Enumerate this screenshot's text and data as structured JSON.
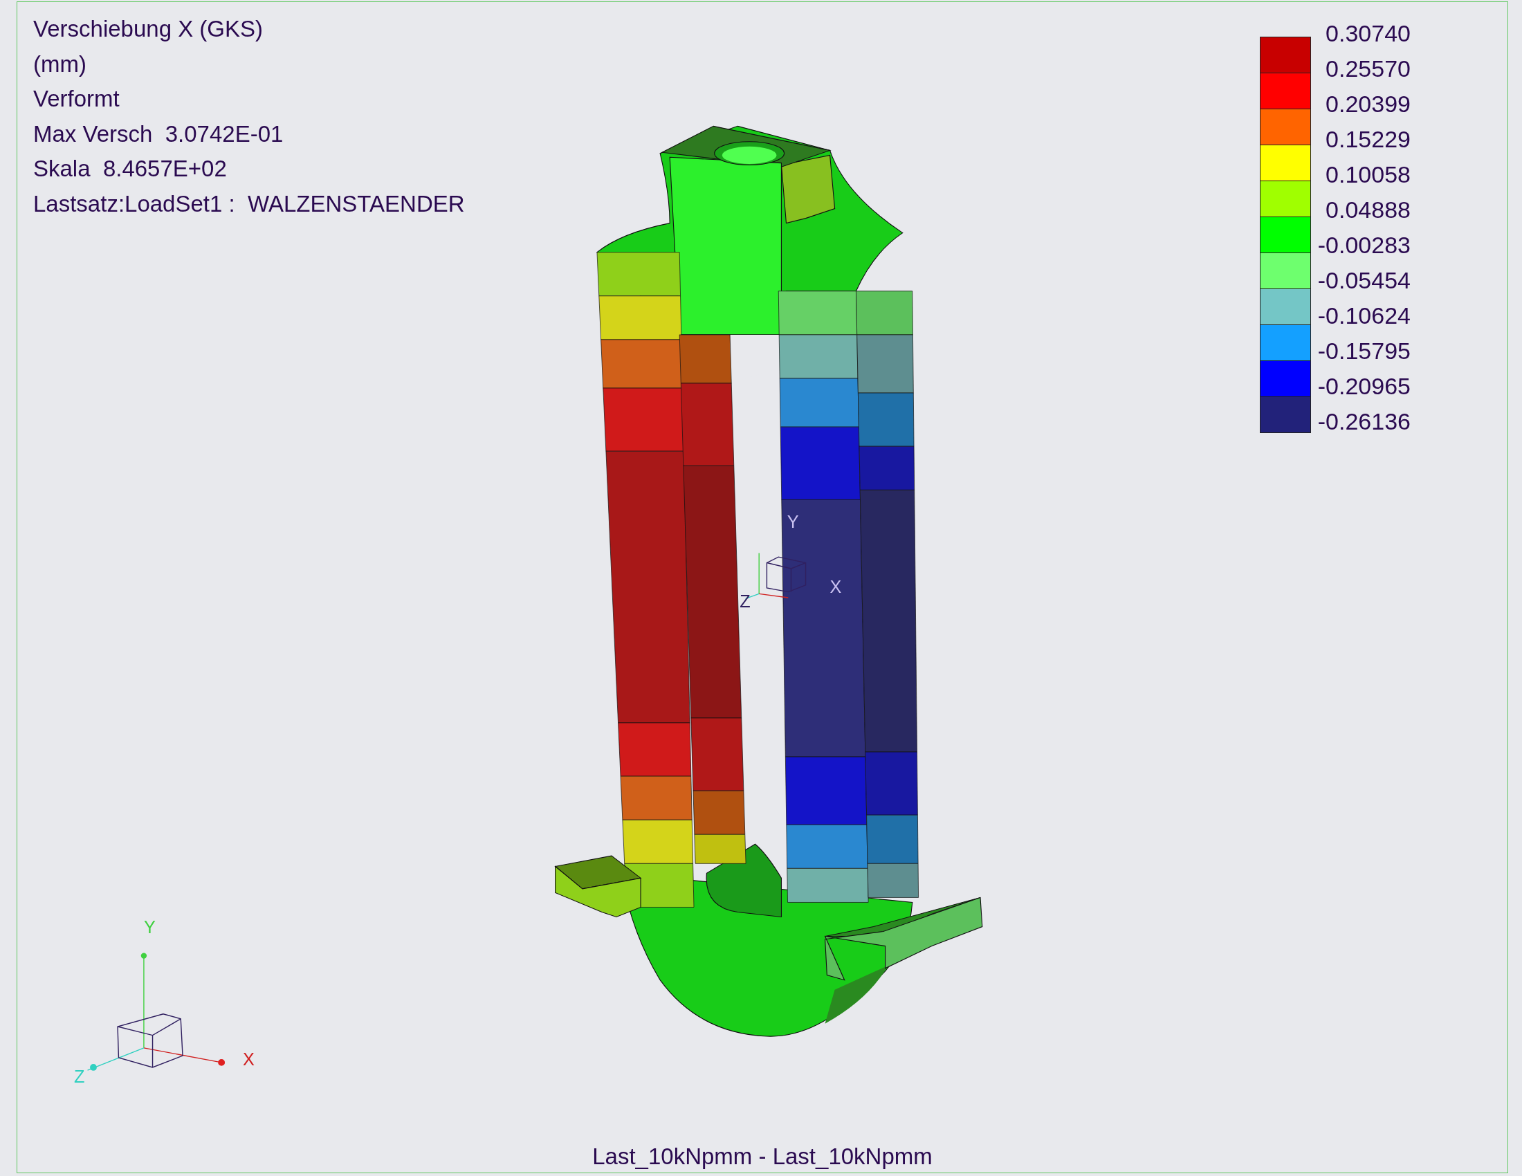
{
  "info_lines": [
    "Verschiebung X (GKS)",
    "(mm)",
    "Verformt",
    "Max Versch  3.0742E-01",
    "Skala  8.4657E+02",
    "Lastsatz:LoadSet1 :  WALZENSTAENDER"
  ],
  "legend": {
    "bands": [
      {
        "color": "#c80000"
      },
      {
        "color": "#ff0000"
      },
      {
        "color": "#ff6400"
      },
      {
        "color": "#ffff00"
      },
      {
        "color": "#a0ff00"
      },
      {
        "color": "#00ff00"
      },
      {
        "color": "#6eff6e"
      },
      {
        "color": "#74c6c6"
      },
      {
        "color": "#14a0ff"
      },
      {
        "color": "#0000ff"
      },
      {
        "color": "#22227a"
      }
    ],
    "labels": [
      "0.30740",
      "0.25570",
      "0.20399",
      "0.15229",
      "0.10058",
      "0.04888",
      "-0.00283",
      "-0.05454",
      "-0.10624",
      "-0.15795",
      "-0.20965",
      "-0.26136"
    ]
  },
  "model_triad": {
    "x_label": "X",
    "y_label": "Y",
    "z_label": "Z"
  },
  "view_triad": {
    "x_label": "X",
    "y_label": "Y",
    "z_label": "Z"
  },
  "caption": "Last_10kNpmm - Last_10kNpmm"
}
